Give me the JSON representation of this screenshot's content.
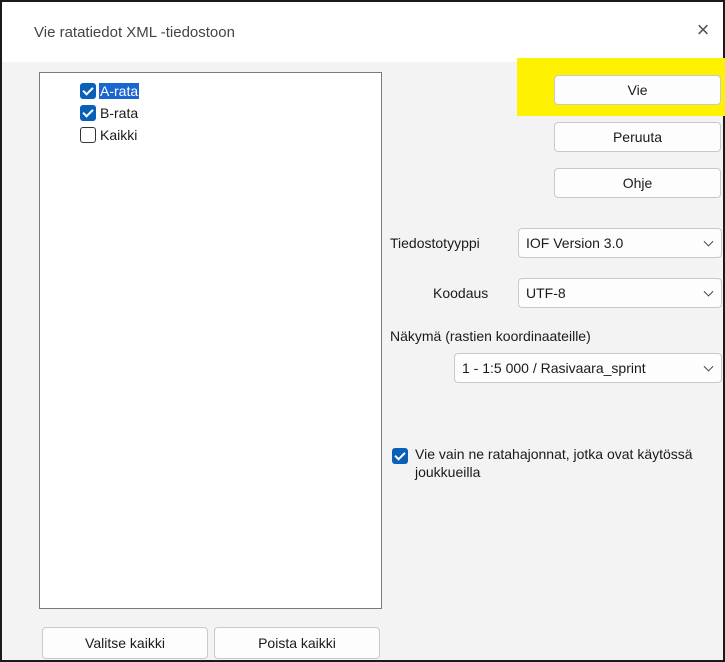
{
  "window": {
    "title": "Vie ratatiedot XML -tiedostoon",
    "close_glyph": "×"
  },
  "courses": [
    {
      "label": "A-rata",
      "checked": true,
      "selected": true
    },
    {
      "label": "B-rata",
      "checked": true,
      "selected": false
    },
    {
      "label": "Kaikki",
      "checked": false,
      "selected": false
    }
  ],
  "buttons": {
    "export": "Vie",
    "cancel": "Peruuta",
    "help": "Ohje",
    "select_all": "Valitse kaikki",
    "deselect_all": "Poista kaikki"
  },
  "file_type": {
    "label": "Tiedostotyyppi",
    "value": "IOF Version 3.0"
  },
  "encoding": {
    "label": "Koodaus",
    "value": "UTF-8"
  },
  "view": {
    "label": "Näkymä (rastien koordinaateille)",
    "value": "1 - 1:5 000 / Rasivaara_sprint"
  },
  "only_used": {
    "label": "Vie vain ne ratahajonnat, jotka ovat käytössä joukkueilla",
    "checked": true
  },
  "colors": {
    "accent": "#0a5fb8",
    "highlight": "#fff200",
    "selection": "#1a66d0"
  }
}
